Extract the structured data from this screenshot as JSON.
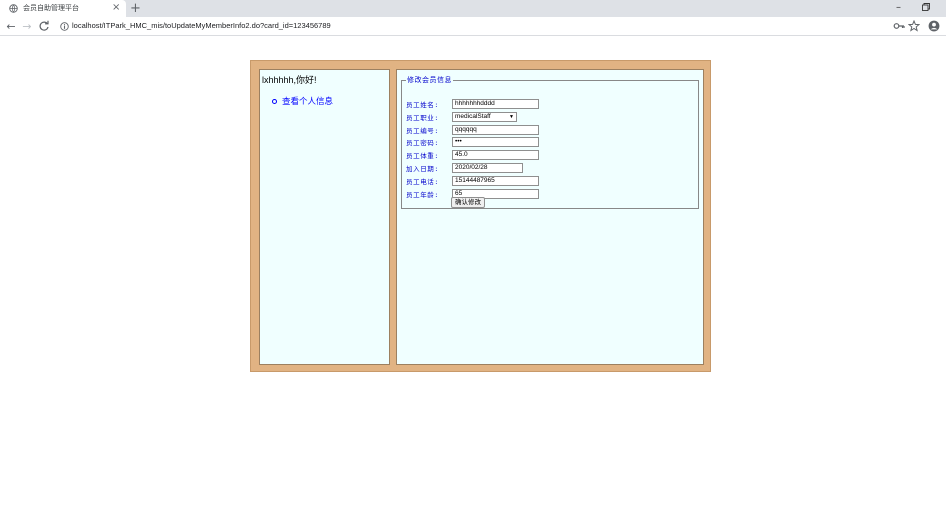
{
  "browser": {
    "tab_title": "会员自助管理平台",
    "tab_close": "×",
    "new_tab": "+",
    "minimize": "–",
    "url": "localhost/ITPark_HMC_mis/toUpdateMyMemberInfo2.do?card_id=123456789"
  },
  "sidebar": {
    "greeting": "lxhhhhh,你好!",
    "items": [
      {
        "label": "查看个人信息"
      }
    ]
  },
  "form": {
    "legend": "修改会员信息",
    "fields": [
      {
        "label": "员工姓名:",
        "value": "hhhhhhhdddd"
      },
      {
        "label": "员工职业:",
        "value": "medicalStaff"
      },
      {
        "label": "员工编号:",
        "value": "qqqqqq"
      },
      {
        "label": "员工密码:",
        "value": "•••"
      },
      {
        "label": "员工体重:",
        "value": "45.0"
      },
      {
        "label": "加入日期:",
        "value": "2020/02/28"
      },
      {
        "label": "员工电话:",
        "value": "15144487965"
      },
      {
        "label": "员工年龄:",
        "value": "65"
      }
    ],
    "submit_label": "确认修改"
  }
}
